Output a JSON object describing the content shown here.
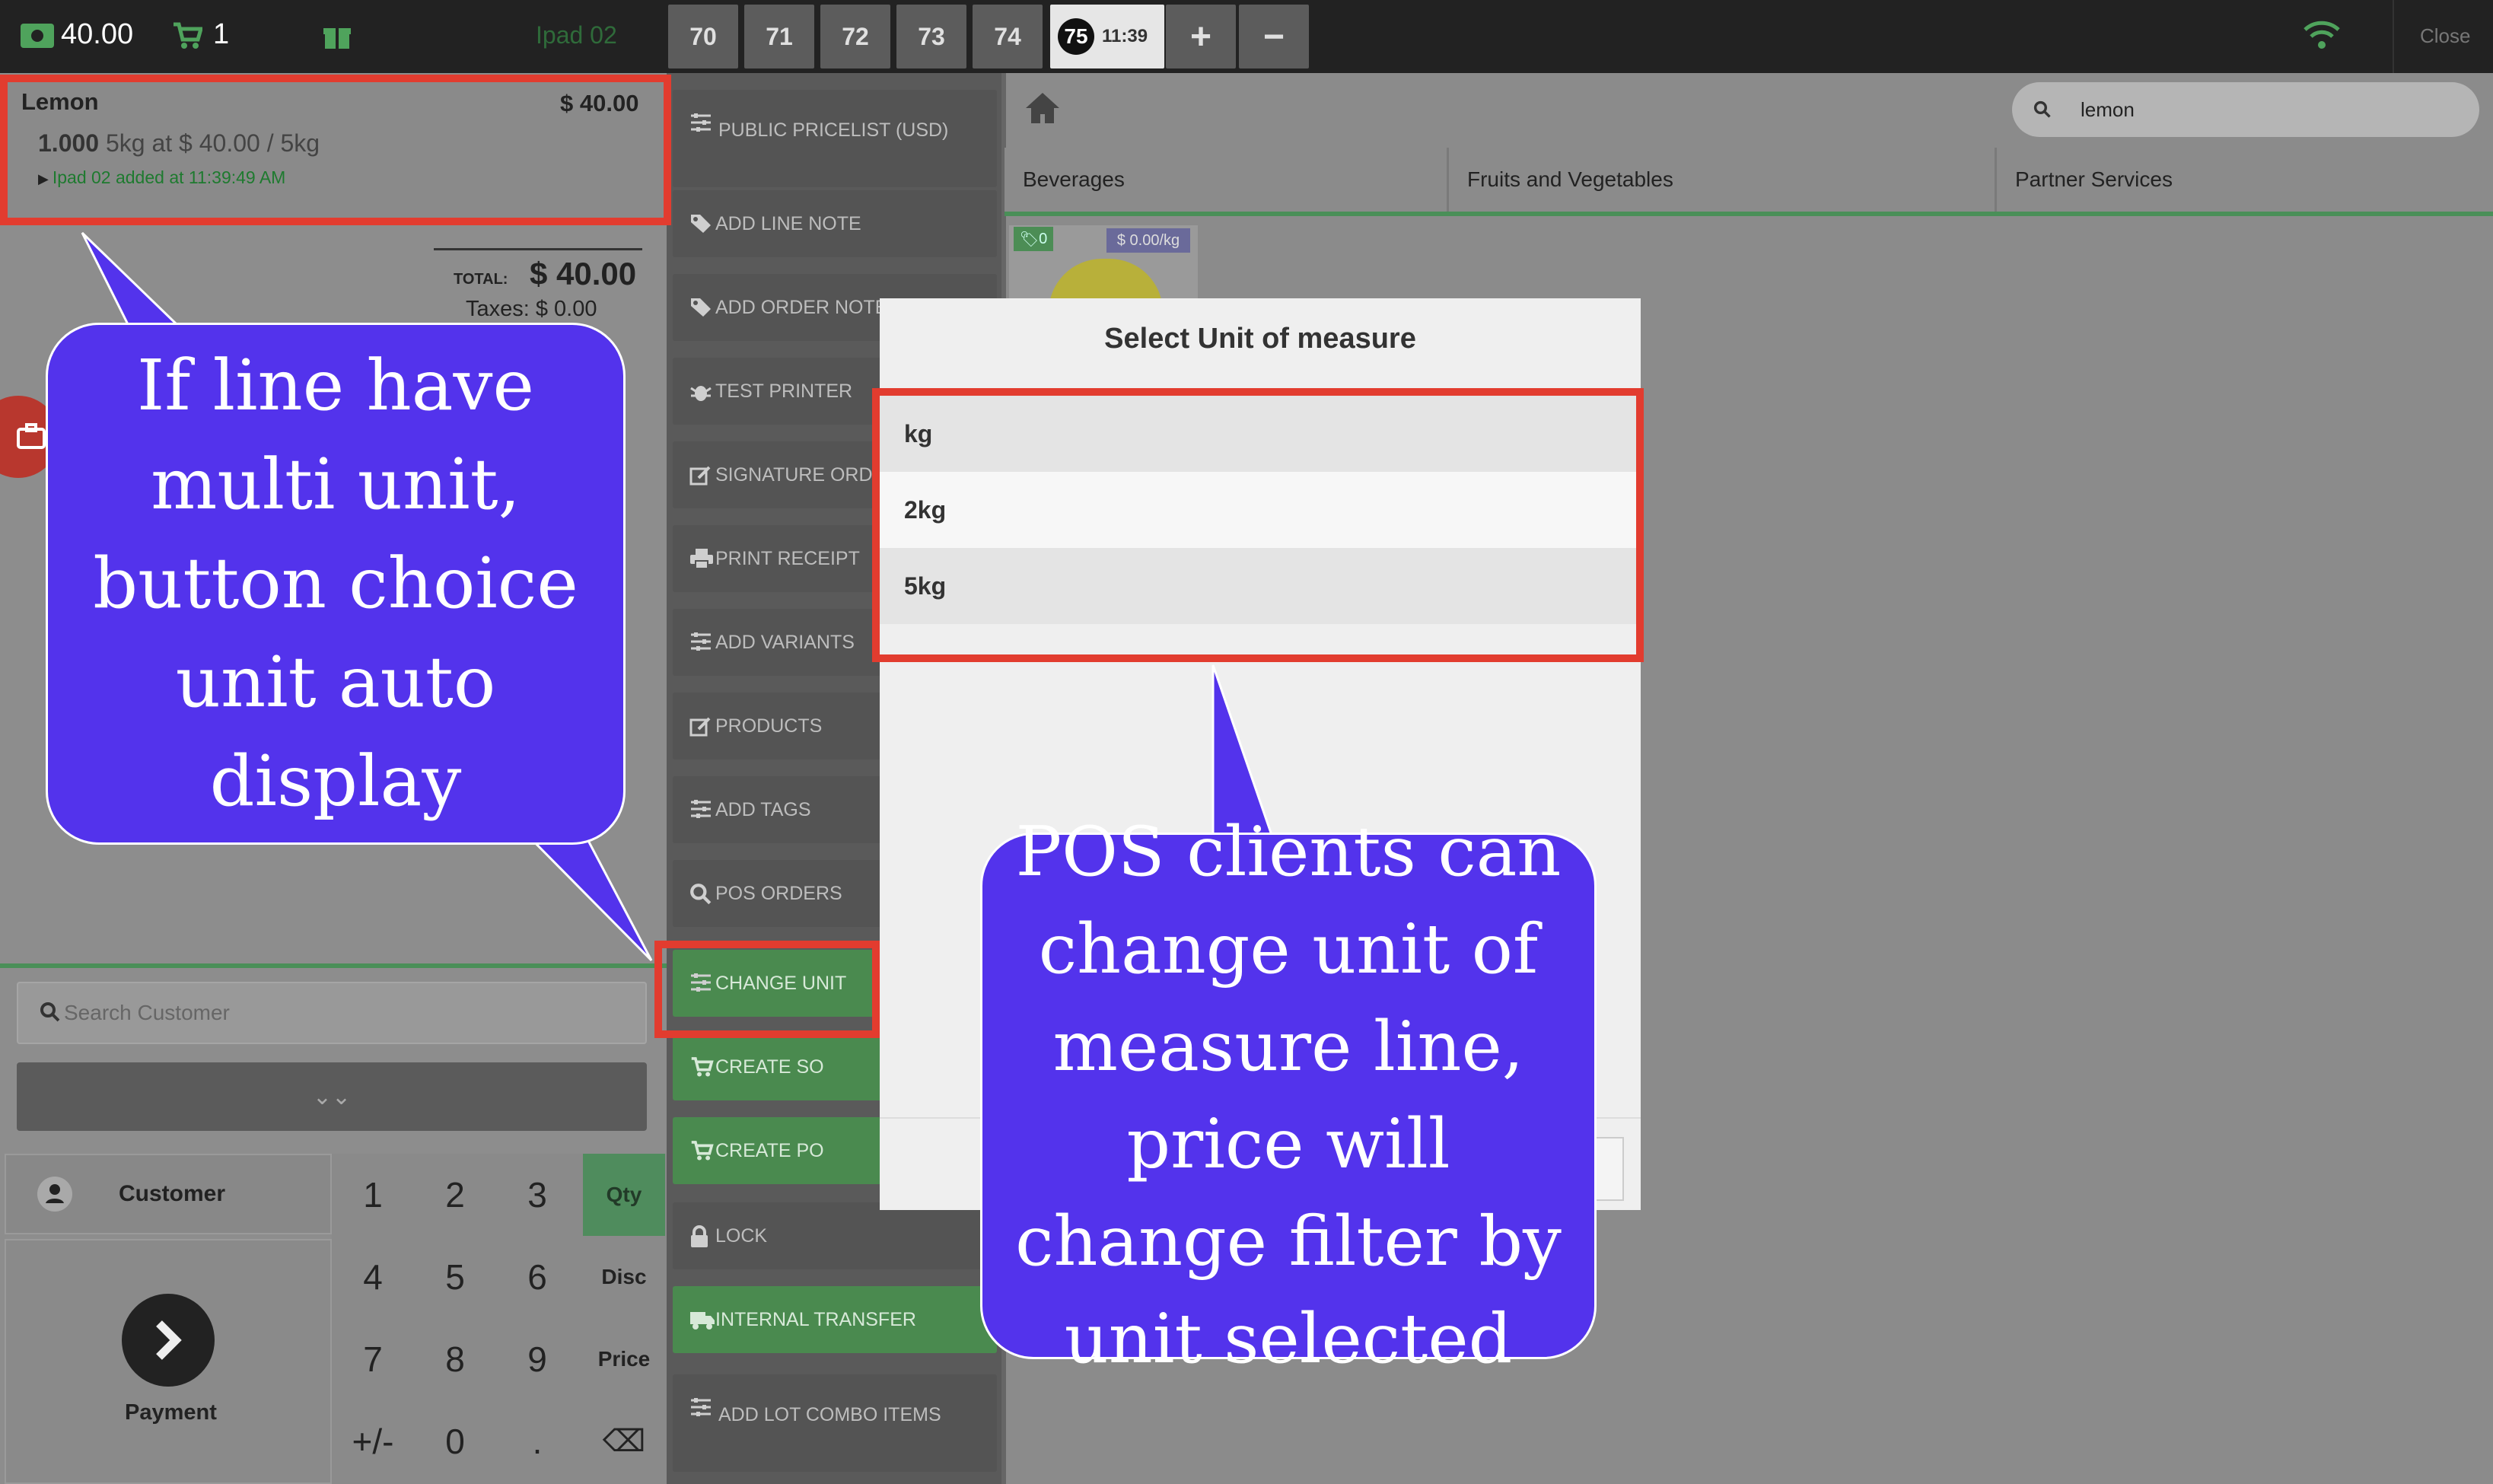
{
  "topbar": {
    "cash": "40.00",
    "cart_count": "1",
    "device": "Ipad 02",
    "tabs": [
      "70",
      "71",
      "72",
      "73",
      "74"
    ],
    "active_tab": {
      "number": "75",
      "time": "11:39"
    },
    "add": "+",
    "remove": "−",
    "close": "Close"
  },
  "order": {
    "line": {
      "name": "Lemon",
      "price": "$ 40.00",
      "qty": "1.000",
      "detail": " 5kg at $ 40.00 / 5kg",
      "added": "Ipad 02 added at 11:39:49 AM"
    },
    "total_label": "TOTAL:",
    "total_value": "$ 40.00",
    "taxes": "Taxes: $ 0.00"
  },
  "customer": {
    "search_placeholder": "Search Customer",
    "expand": "⌄⌄",
    "customer_label": "Customer",
    "payment_label": "Payment"
  },
  "numpad": {
    "keys": [
      "1",
      "2",
      "3",
      "4",
      "5",
      "6",
      "7",
      "8",
      "9",
      "+/-",
      "0",
      "."
    ],
    "modes": [
      "Qty",
      "Disc",
      "Price"
    ],
    "backspace": "⌫"
  },
  "actions": [
    {
      "label": "PUBLIC PRICELIST (USD)",
      "icon": "sliders-icon"
    },
    {
      "label": "ADD LINE NOTE",
      "icon": "tag-icon"
    },
    {
      "label": "ADD ORDER NOTE",
      "icon": "tag-icon"
    },
    {
      "label": "TEST PRINTER",
      "icon": "bug-icon"
    },
    {
      "label": "SIGNATURE ORDER",
      "icon": "edit-icon"
    },
    {
      "label": "PRINT RECEIPT",
      "icon": "print-icon"
    },
    {
      "label": "ADD VARIANTS",
      "icon": "sliders-icon"
    },
    {
      "label": "PRODUCTS",
      "icon": "edit-icon"
    },
    {
      "label": "ADD TAGS",
      "icon": "sliders-icon"
    },
    {
      "label": "POS ORDERS",
      "icon": "search-icon"
    },
    {
      "label": "CHANGE UNIT",
      "icon": "sliders-icon"
    },
    {
      "label": "CREATE SO",
      "icon": "cart-icon"
    },
    {
      "label": "CREATE PO",
      "icon": "cart-icon"
    },
    {
      "label": "LOCK",
      "icon": "lock-icon"
    },
    {
      "label": "INTERNAL TRANSFER",
      "icon": "truck-icon"
    },
    {
      "label": "ADD LOT COMBO ITEMS",
      "icon": "sliders-icon"
    }
  ],
  "products": {
    "search_value": "lemon",
    "categories": [
      "Beverages",
      "Fruits and Vegetables",
      "Partner Services"
    ],
    "card": {
      "tag": "0",
      "price": "$ 0.00/kg"
    }
  },
  "modal": {
    "title": "Select Unit of measure",
    "options": [
      "kg",
      "2kg",
      "5kg"
    ]
  },
  "annotations": {
    "left": "If line have multi unit, button choice unit auto display",
    "right": "POS clients can change unit of measure line, price will change filter by unit selected"
  },
  "colors": {
    "annotation_fill": "#5333ec",
    "highlight_border": "#e23c2f",
    "accent_green": "#4a8a4f"
  }
}
